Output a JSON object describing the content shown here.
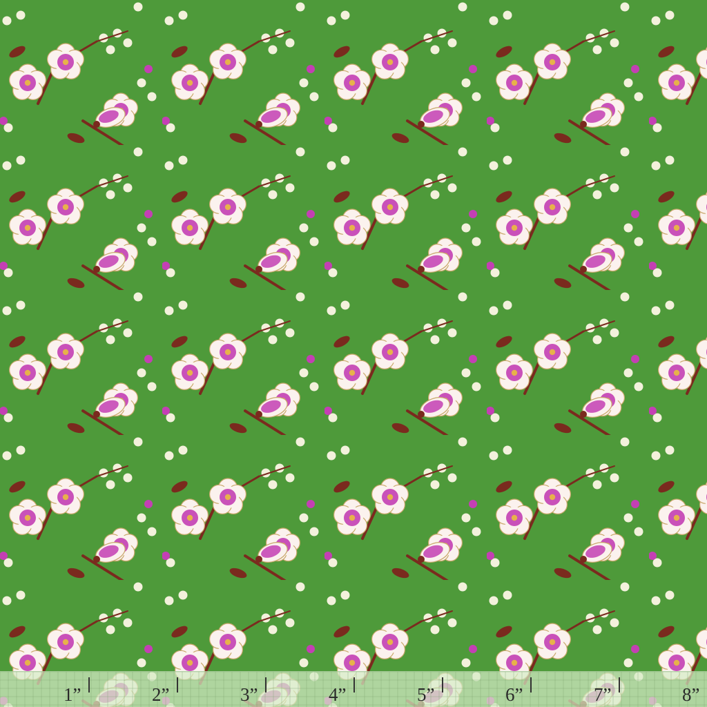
{
  "swatch": {
    "background_color": "#4e9a3a",
    "flower_petal_color": "#fbf2ee",
    "flower_center_color": "#c43fb4",
    "flower_outline_color": "#c9a86a",
    "stem_color": "#7a2a1e",
    "bud_color": "#f3f1dc",
    "accent_dot_color": "#c43fb4"
  },
  "ruler": {
    "unit_marks": [
      {
        "label": "1”"
      },
      {
        "label": "2”"
      },
      {
        "label": "3”"
      },
      {
        "label": "4”"
      },
      {
        "label": "5”"
      },
      {
        "label": "6”"
      },
      {
        "label": "7”"
      },
      {
        "label": "8”"
      }
    ]
  }
}
